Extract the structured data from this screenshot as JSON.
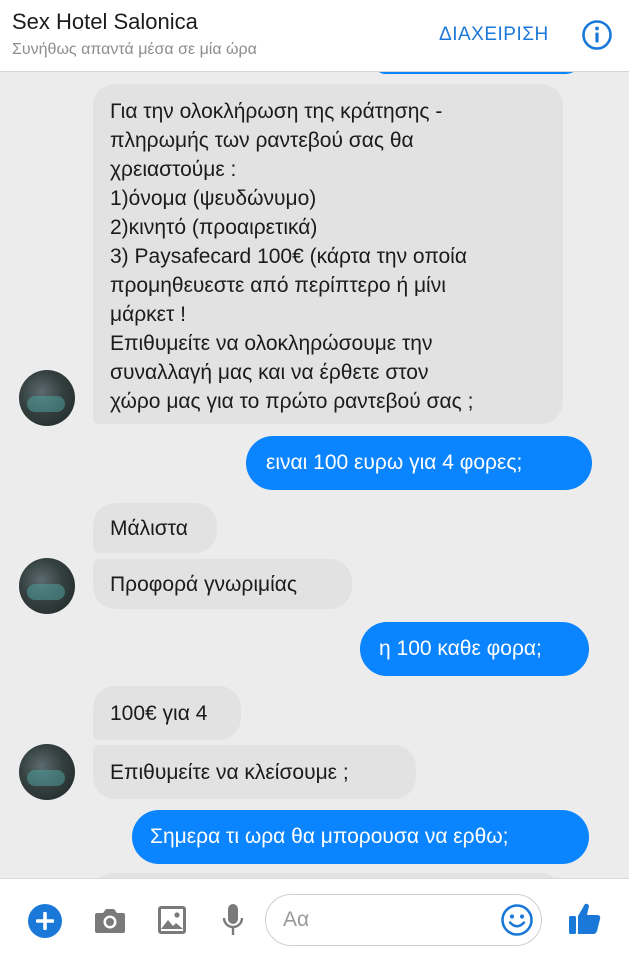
{
  "header": {
    "title": "Sex Hotel Salonica",
    "subtitle": "Συνήθως απαντά μέσα σε μία ώρα",
    "manage_label": "ΔΙΑΧΕΙΡΙΣΗ",
    "info_icon": "info-icon"
  },
  "messages": [
    {
      "from": "page",
      "text": "Για την ολοκλήρωση της κράτησης -\nπληρωμής των ραντεβού σας θα\nχρειαστούμε :\n1)όνομα (ψευδώνυμο)\n2)κινητό (προαιρετικά)\n3) Paysafecard 100€ (κάρτα την οποία\nπρομηθευεστε από περίπτερο ή μίνι\nμάρκετ !\nΕπιθυμείτε να ολοκληρώσουμε την\nσυναλλαγή μας και να έρθετε στον\nχώρο μας για το πρώτο ραντεβού σας ;"
    },
    {
      "from": "user",
      "text": "ειναι 100 ευρω για 4 φορες;"
    },
    {
      "from": "page",
      "text": "Μάλιστα"
    },
    {
      "from": "page",
      "text": "Προφορά γνωριμίας"
    },
    {
      "from": "user",
      "text": "η 100 καθε φορα;"
    },
    {
      "from": "page",
      "text": "100€ για 4"
    },
    {
      "from": "page",
      "text": "Επιθυμείτε να κλείσουμε ;"
    },
    {
      "from": "user",
      "text": "Σημερα τι ωρα θα μπορουσα να ερθω;"
    }
  ],
  "composer": {
    "placeholder": "Aα",
    "icons": [
      "plus-icon",
      "camera-icon",
      "image-icon",
      "microphone-icon",
      "emoji-icon",
      "thumbs-up-icon"
    ]
  },
  "colors": {
    "accent": "#0a84ff",
    "incoming_bubble": "#e2e2e2",
    "background": "#ececec"
  }
}
